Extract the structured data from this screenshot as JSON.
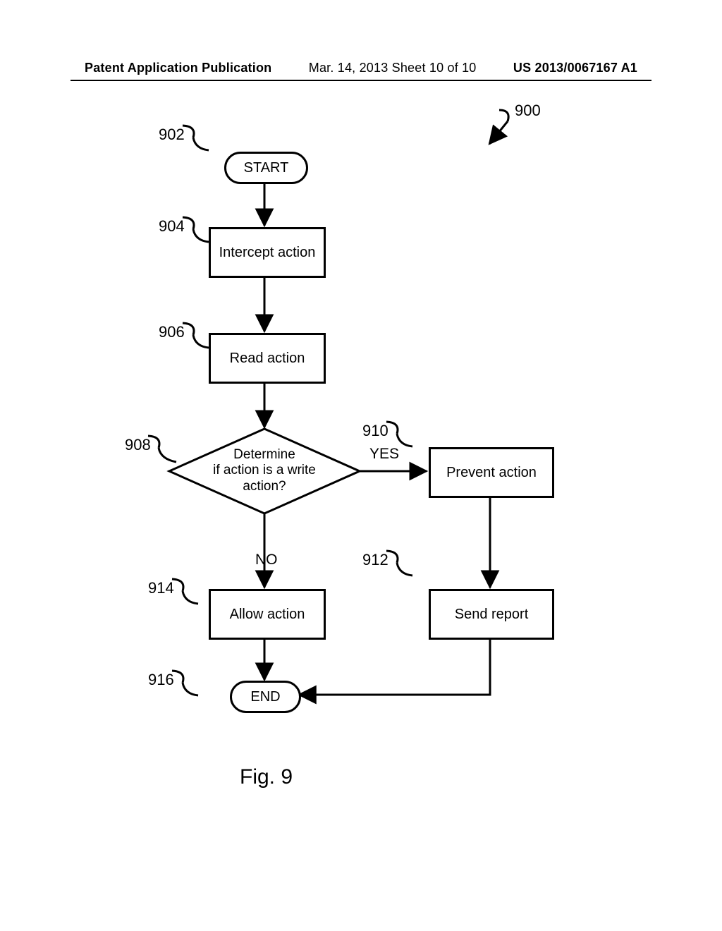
{
  "header": {
    "pub_label": "Patent Application Publication",
    "pub_date": "Mar. 14, 2013  Sheet 10 of 10",
    "pub_num": "US 2013/0067167 A1"
  },
  "refs": {
    "r900": "900",
    "r902": "902",
    "r904": "904",
    "r906": "906",
    "r908": "908",
    "r910": "910",
    "r912": "912",
    "r914": "914",
    "r916": "916"
  },
  "nodes": {
    "start": "START",
    "intercept": "Intercept action",
    "read": "Read action",
    "decision": "Determine\nif action is a write\naction?",
    "prevent": "Prevent action",
    "allow": "Allow action",
    "send": "Send report",
    "end": "END"
  },
  "edges": {
    "yes": "YES",
    "no": "NO"
  },
  "caption": "Fig. 9",
  "chart_data": {
    "type": "flowchart",
    "title": "Fig. 9",
    "figure_ref": "900",
    "nodes": [
      {
        "id": "902",
        "type": "terminator",
        "label": "START"
      },
      {
        "id": "904",
        "type": "process",
        "label": "Intercept action"
      },
      {
        "id": "906",
        "type": "process",
        "label": "Read action"
      },
      {
        "id": "908",
        "type": "decision",
        "label": "Determine if action is a write action?"
      },
      {
        "id": "910",
        "type": "process",
        "label": "Prevent action"
      },
      {
        "id": "912",
        "type": "process",
        "label": "Send report"
      },
      {
        "id": "914",
        "type": "process",
        "label": "Allow action"
      },
      {
        "id": "916",
        "type": "terminator",
        "label": "END"
      }
    ],
    "edges": [
      {
        "from": "902",
        "to": "904"
      },
      {
        "from": "904",
        "to": "906"
      },
      {
        "from": "906",
        "to": "908"
      },
      {
        "from": "908",
        "to": "910",
        "label": "YES"
      },
      {
        "from": "908",
        "to": "914",
        "label": "NO"
      },
      {
        "from": "910",
        "to": "912"
      },
      {
        "from": "912",
        "to": "916"
      },
      {
        "from": "914",
        "to": "916"
      }
    ]
  }
}
